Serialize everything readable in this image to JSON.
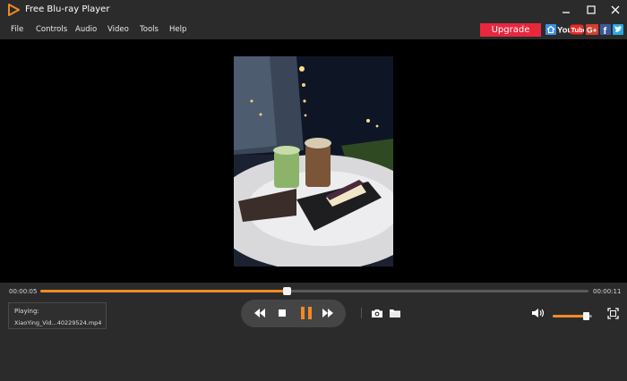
{
  "window": {
    "title": "Free Blu-ray Player",
    "logo_icon": "play-triangle-logo-icon",
    "accent_color": "#f08a24"
  },
  "menu": {
    "items": [
      "File",
      "Controls",
      "Audio",
      "Video",
      "Tools",
      "Help"
    ],
    "upgrade_label": "Upgrade",
    "upgrade_color": "#e8273d",
    "social": [
      {
        "icon": "home-icon"
      },
      {
        "icon": "youtube-icon",
        "label": "You"
      },
      {
        "icon": "google-plus-icon",
        "label": "G+"
      },
      {
        "icon": "facebook-icon",
        "label": "f"
      },
      {
        "icon": "twitter-icon"
      }
    ],
    "youtube_tube": "Tube"
  },
  "playback": {
    "current_time": "00:00:05",
    "total_time": "00:00:11",
    "progress_fraction": 0.45,
    "playing_label": "Playing:",
    "file_name": "XiaoYing_Vid...40229524.mp4",
    "state": "playing",
    "volume_fraction": 0.85
  }
}
